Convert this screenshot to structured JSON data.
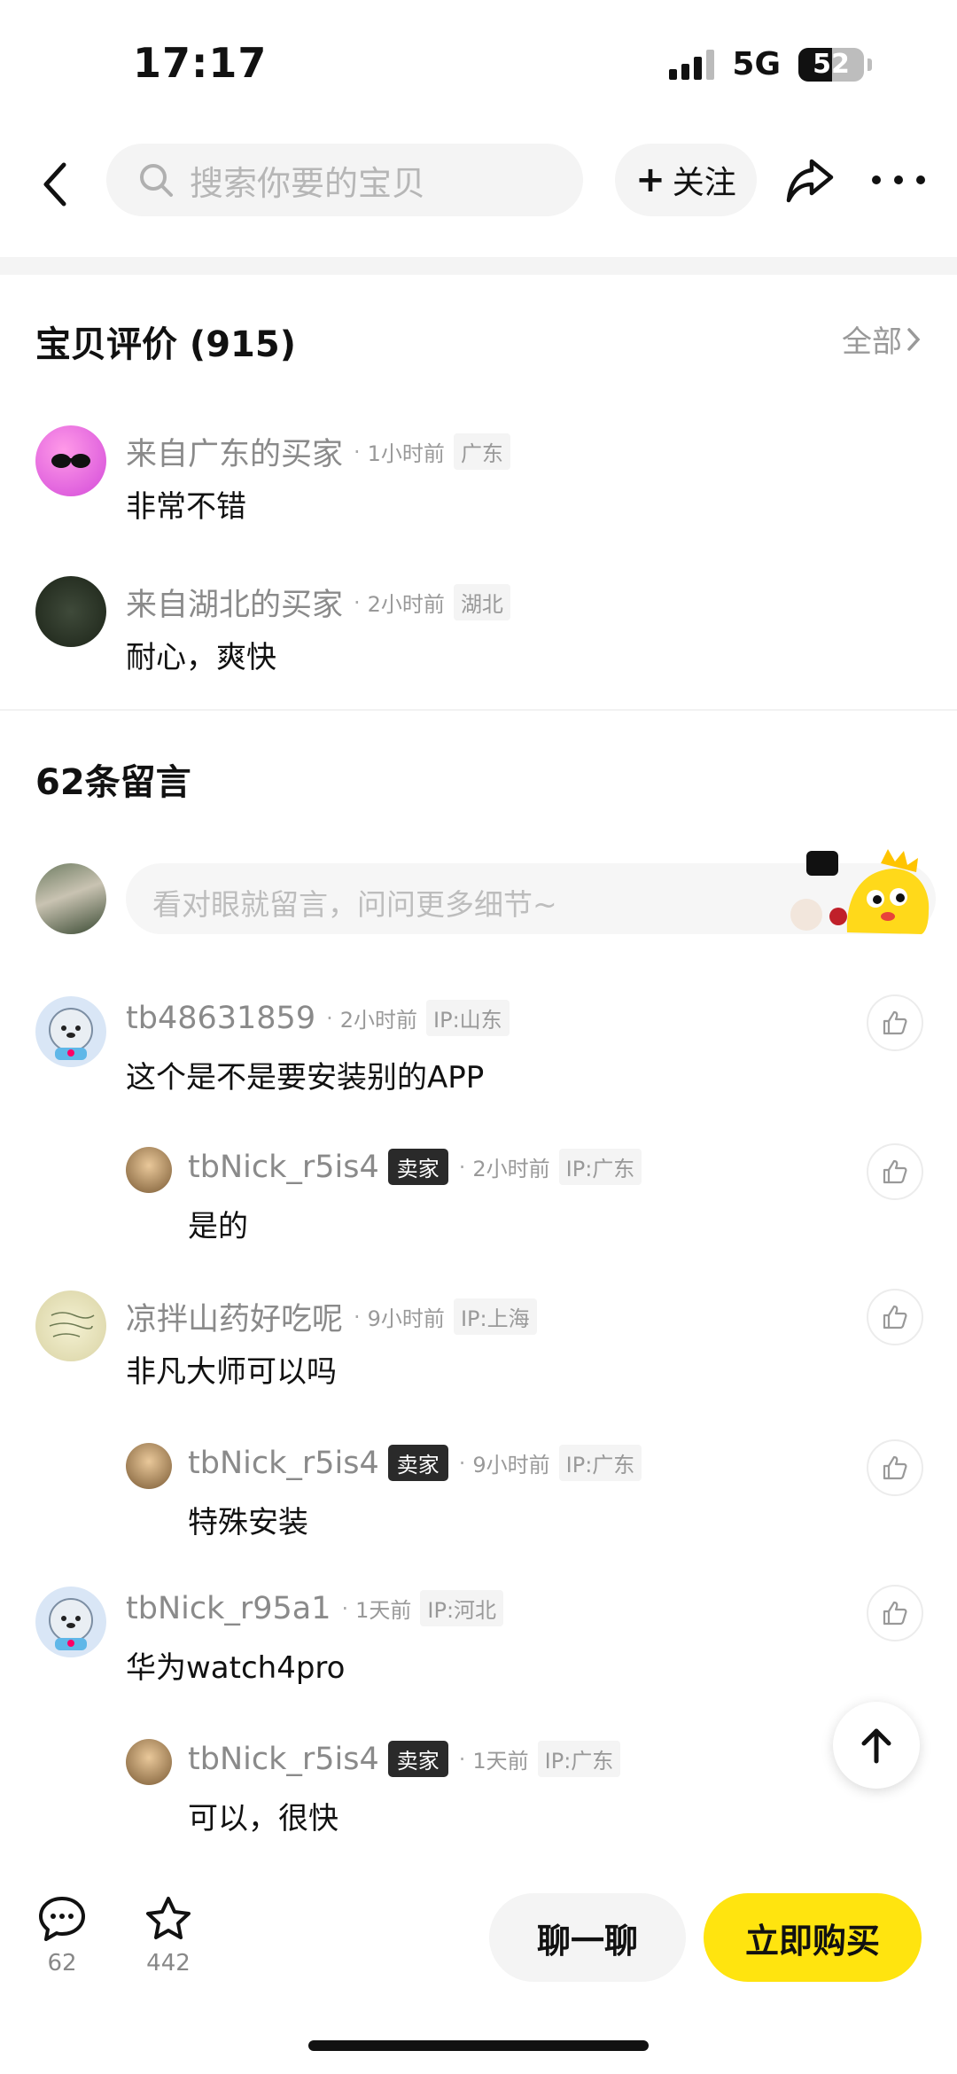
{
  "status_bar": {
    "time": "17:17",
    "network": "5G",
    "battery": "52",
    "battery_level_percent": 52
  },
  "nav": {
    "search_placeholder": "搜索你要的宝贝",
    "follow_label": "关注"
  },
  "reviews": {
    "title": "宝贝评价 (915)",
    "all_label": "全部",
    "items": [
      {
        "user": "来自广东的买家",
        "time": "1小时前",
        "tag": "广东",
        "text": "非常不错"
      },
      {
        "user": "来自湖北的买家",
        "time": "2小时前",
        "tag": "湖北",
        "text": "耐心，爽快"
      }
    ]
  },
  "comments": {
    "title": "62条留言",
    "input_placeholder": "看对眼就留言，问问更多细节~",
    "items": [
      {
        "user": "tb48631859",
        "time": "2小时前",
        "ip": "IP:山东",
        "text": "这个是不是要安装别的APP"
      },
      {
        "user": "tbNick_r5is4",
        "badge": "卖家",
        "time": "2小时前",
        "ip": "IP:广东",
        "text": "是的"
      },
      {
        "user": "凉拌山药好吃呢",
        "time": "9小时前",
        "ip": "IP:上海",
        "text": "非凡大师可以吗"
      },
      {
        "user": "tbNick_r5is4",
        "badge": "卖家",
        "time": "9小时前",
        "ip": "IP:广东",
        "text": "特殊安装"
      },
      {
        "user": "tbNick_r95a1",
        "time": "1天前",
        "ip": "IP:河北",
        "text": "华为watch4pro"
      },
      {
        "user": "tbNick_r5is4",
        "badge": "卖家",
        "time": "1天前",
        "ip": "IP:广东",
        "text": "可以，很快"
      }
    ]
  },
  "bottom_bar": {
    "comment_count": "62",
    "favorite_count": "442",
    "chat_label": "聊一聊",
    "buy_label": "立即购买"
  },
  "colors": {
    "accent_yellow": "#ffe40f",
    "muted_text": "#8a8a8a",
    "seller_badge_bg": "#2a2a2a"
  }
}
